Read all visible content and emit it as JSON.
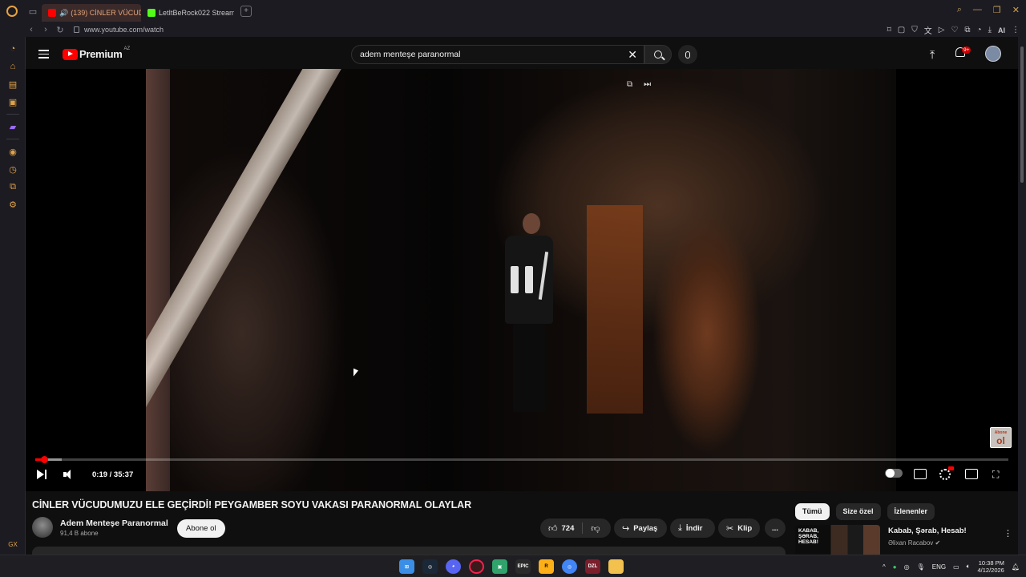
{
  "browser": {
    "tabs": [
      {
        "label": "(139) CİNLER VÜCUDU",
        "active": true
      },
      {
        "label": "LetItBeRock022 Stream - ",
        "active": false
      }
    ],
    "url": "www.youtube.com/watch",
    "ai_label": "AI",
    "sidebar_bottom": "GX"
  },
  "youtube": {
    "logo_text": "Premium",
    "logo_country": "AZ",
    "search_value": "adem menteşe paranormal",
    "notification_badge": "9+",
    "player": {
      "time": "0:19 / 35:37",
      "progress_fraction": 0.009,
      "buffer_fraction": 0.027,
      "watermark_top": "Abone",
      "watermark_big": "ol"
    },
    "video_title": "CİNLER VÜCUDUMUZU ELE GEÇİRDİ! PEYGAMBER SOYU VAKASI PARANORMAL OLAYLAR",
    "channel": {
      "name": "Adem Menteşe Paranormal",
      "subscribers": "91,4 B abone",
      "subscribe_label": "Abone ol"
    },
    "actions": {
      "likes": "724",
      "share": "Paylaş",
      "download": "İndir",
      "clip": "Klip",
      "more": "..."
    },
    "chips": [
      "Tümü",
      "Size özel",
      "İzlenenler"
    ],
    "recommendation": {
      "thumb_text": "KABAB, ŞƏRAB, HESAB!",
      "title": "Kabab, Şərab, Hesab!",
      "channel": "Əlixan Racabov"
    }
  },
  "taskbar": {
    "lang": "ENG",
    "time": "10:38 PM",
    "date": "4/12/2026",
    "apps": [
      "windows-icon",
      "steam-icon",
      "discord-icon",
      "opera-gx-icon",
      "app-icon",
      "epic-games-icon",
      "rockstar-icon",
      "chrome-icon",
      "dzl-icon",
      "file-explorer-icon"
    ],
    "app_labels": {
      "epic": "EPIC",
      "rockstar": "R",
      "dzl": "DZL"
    }
  },
  "colors": {
    "accent_gx": "#e8a33d",
    "youtube_red": "#ff0000"
  }
}
